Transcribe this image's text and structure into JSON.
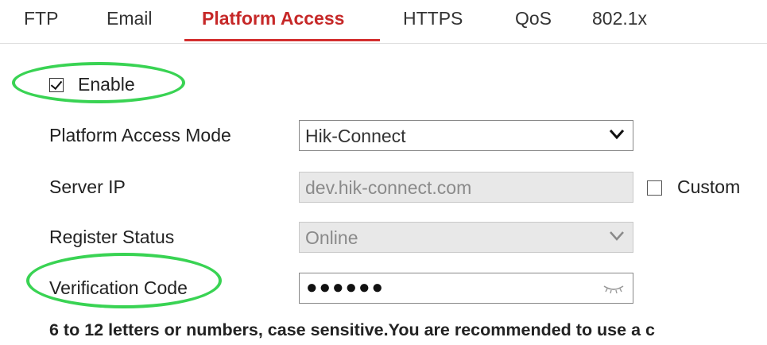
{
  "tabs": [
    {
      "label": "FTP"
    },
    {
      "label": "Email"
    },
    {
      "label": "Platform Access",
      "active": true
    },
    {
      "label": "HTTPS"
    },
    {
      "label": "QoS"
    },
    {
      "label": "802.1x"
    }
  ],
  "enable": {
    "label": "Enable",
    "checked": true
  },
  "fields": {
    "mode": {
      "label": "Platform Access Mode",
      "value": "Hik-Connect"
    },
    "server_ip": {
      "label": "Server IP",
      "value": "dev.hik-connect.com",
      "custom_label": "Custom",
      "custom_checked": false
    },
    "register_status": {
      "label": "Register Status",
      "value": "Online"
    },
    "verification_code": {
      "label": "Verification Code",
      "value": "●●●●●●"
    }
  },
  "hint": "6 to 12 letters or numbers, case sensitive.You are recommended to use a c",
  "colors": {
    "active_tab": "#c62828",
    "annotation": "#39d353"
  },
  "icons": {
    "dropdown": "chevron-down-icon",
    "password_toggle": "eye-icon",
    "checkbox": "checkbox-icon"
  }
}
